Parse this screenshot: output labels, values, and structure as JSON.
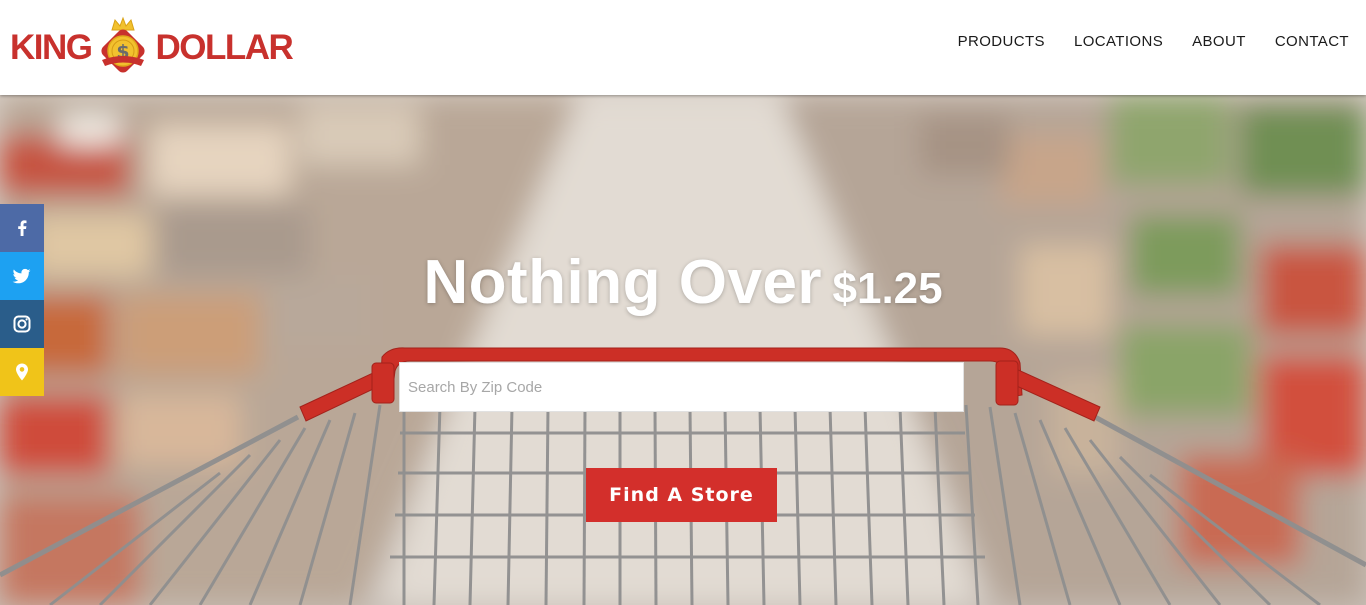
{
  "brand": {
    "word_left": "KING",
    "word_right": "DOLLAR",
    "emblem_glyph": "$",
    "colors": {
      "red": "#c8312d",
      "gold": "#f2c12e"
    }
  },
  "nav": {
    "items": [
      "PRODUCTS",
      "LOCATIONS",
      "ABOUT",
      "CONTACT"
    ]
  },
  "hero": {
    "headline_main": "Nothing Over",
    "headline_price": "$1.25",
    "search": {
      "placeholder": "Search By Zip Code",
      "value": ""
    },
    "button_label": "Find A Store",
    "colors": {
      "button": "#d32f2b"
    }
  },
  "social": {
    "items": [
      {
        "icon": "facebook-icon",
        "color": "#3b5998"
      },
      {
        "icon": "twitter-icon",
        "color": "#1da1f2"
      },
      {
        "icon": "instagram-icon",
        "color": "#2a5d8a"
      },
      {
        "icon": "map-pin-icon",
        "color": "#f0c419"
      }
    ]
  }
}
